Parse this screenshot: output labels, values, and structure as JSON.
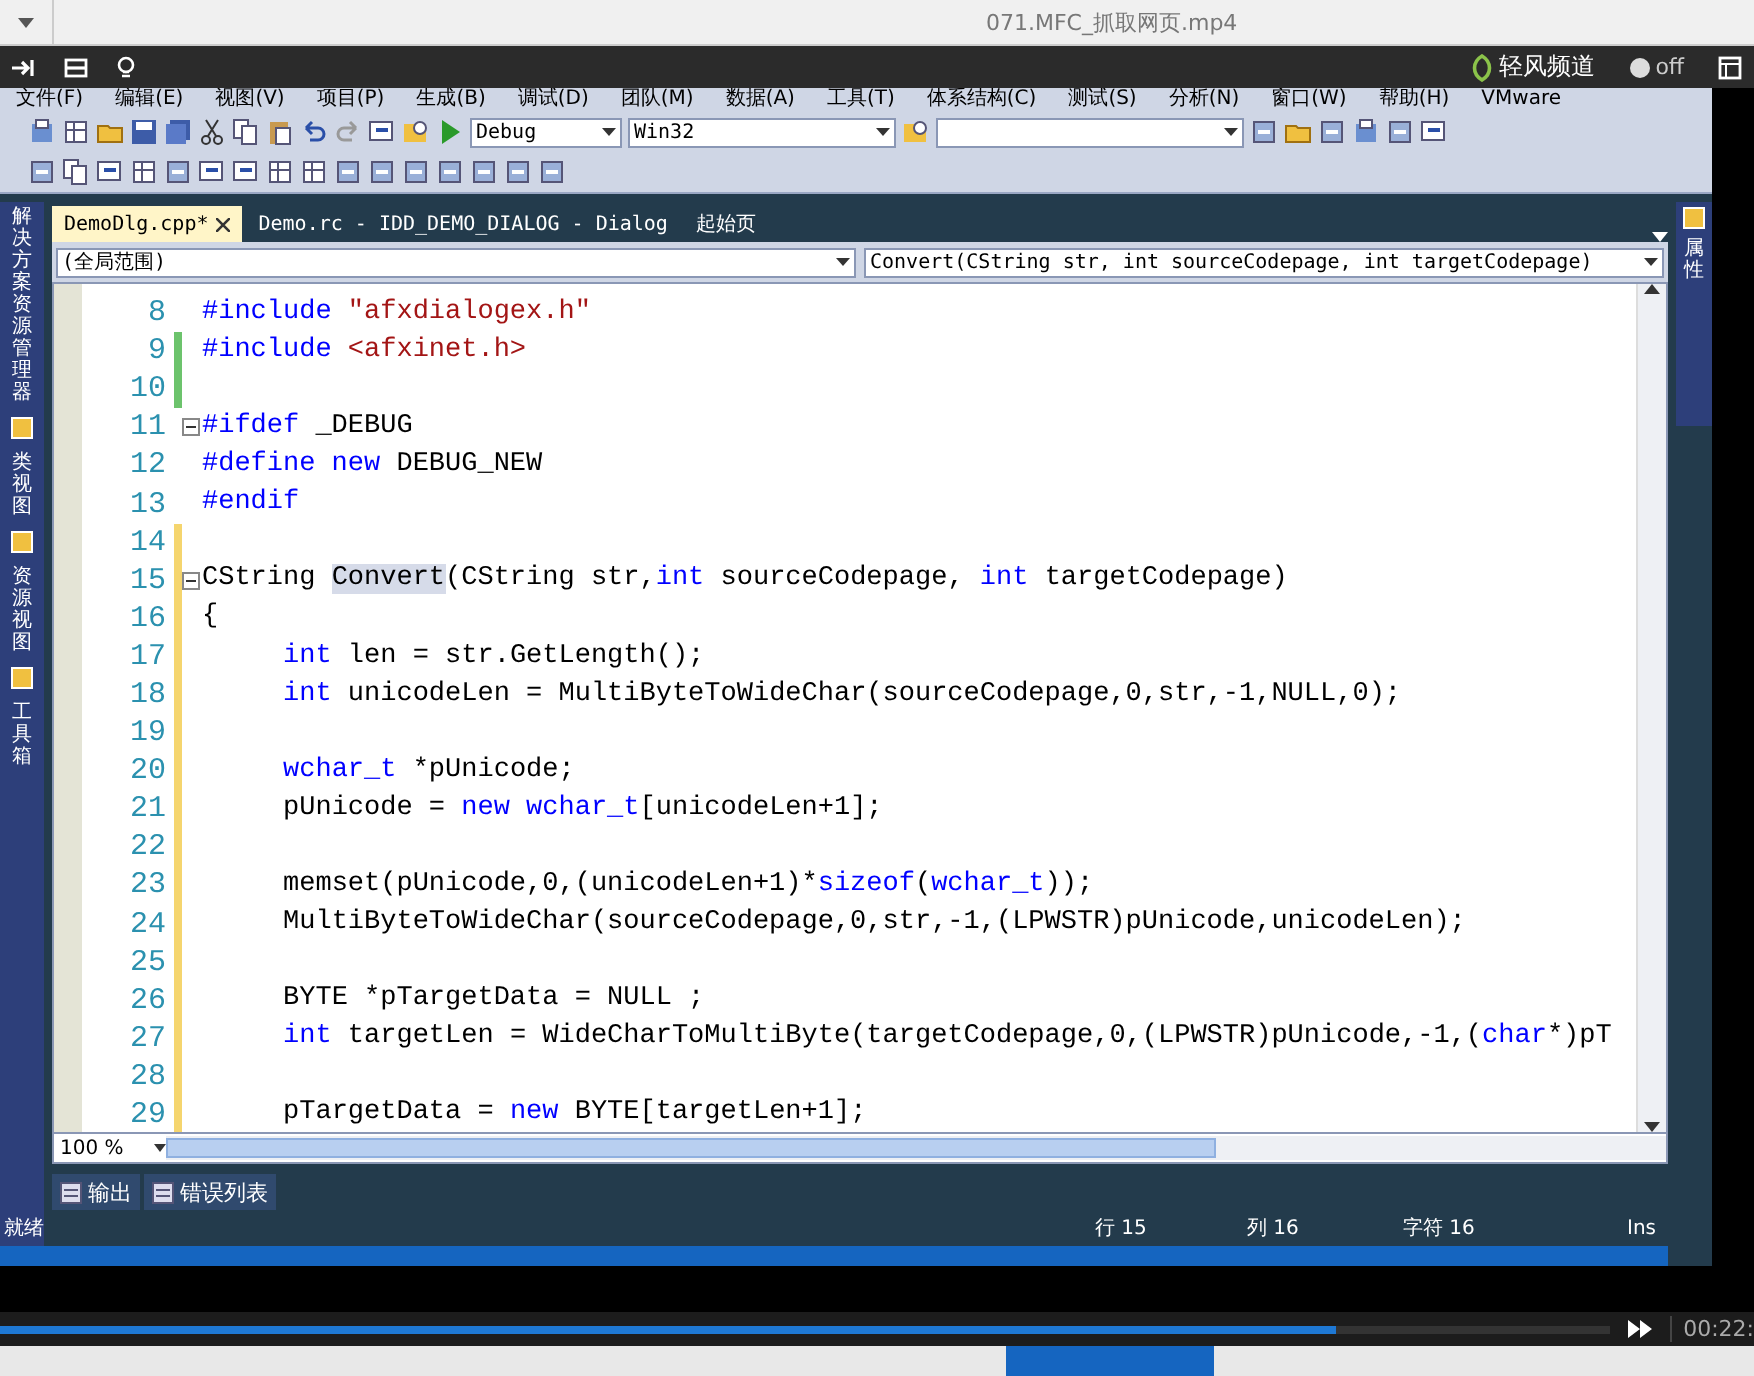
{
  "video_title": "071.MFC_抓取网页.mp4",
  "player_bar": {
    "brand": "轻风频道",
    "toggle": {
      "label": "off",
      "on": false
    }
  },
  "menu": [
    "文件(F)",
    "编辑(E)",
    "视图(V)",
    "项目(P)",
    "生成(B)",
    "调试(D)",
    "团队(M)",
    "数据(A)",
    "工具(T)",
    "体系结构(C)",
    "测试(S)",
    "分析(N)",
    "窗口(W)",
    "帮助(H)",
    "VMware"
  ],
  "toolbar": {
    "configuration": "Debug",
    "platform": "Win32"
  },
  "left_panel": [
    {
      "label": "解决方案资源管理器"
    },
    {
      "label": "类视图"
    },
    {
      "label": "资源视图"
    },
    {
      "label": "工具箱"
    }
  ],
  "right_panel": [
    {
      "label": "属性"
    }
  ],
  "tabs": [
    {
      "label": "DemoDlg.cpp*",
      "selected": true
    },
    {
      "label": "Demo.rc - IDD_DEMO_DIALOG - Dialog",
      "selected": false
    },
    {
      "label": "起始页",
      "selected": false
    }
  ],
  "scope": "(全局范围)",
  "member": "Convert(CString str, int sourceCodepage, int targetCodepage)",
  "code_lines": [
    {
      "number": "8",
      "tokens": [
        {
          "kind": "keyword",
          "text": "#include "
        },
        {
          "kind": "string",
          "text": "\"afxdialogex.h\""
        }
      ]
    },
    {
      "number": "9",
      "color": "#6cc36c",
      "tokens": [
        {
          "kind": "keyword",
          "text": "#include "
        },
        {
          "kind": "string",
          "text": "<afxinet.h>"
        }
      ]
    },
    {
      "number": "10",
      "color": "#6cc36c"
    },
    {
      "number": "11",
      "fold": true,
      "tokens": [
        {
          "kind": "keyword",
          "text": "#ifdef"
        },
        {
          "kind": "plain",
          "text": " _DEBUG"
        }
      ]
    },
    {
      "number": "12",
      "tokens": [
        {
          "kind": "keyword",
          "text": "#define new"
        },
        {
          "kind": "plain",
          "text": " DEBUG_NEW"
        }
      ]
    },
    {
      "number": "13",
      "tokens": [
        {
          "kind": "keyword",
          "text": "#endif"
        }
      ]
    },
    {
      "number": "14",
      "color": "#f5d56e"
    },
    {
      "number": "15",
      "color": "#f5d56e",
      "fold": true,
      "tokens": [
        {
          "kind": "plain",
          "text": "CString "
        },
        {
          "kind": "highlight",
          "text": "Convert"
        },
        {
          "kind": "plain",
          "text": "(CString str,"
        },
        {
          "kind": "keyword",
          "text": "int"
        },
        {
          "kind": "plain",
          "text": " sourceCodepage, "
        },
        {
          "kind": "keyword",
          "text": "int"
        },
        {
          "kind": "plain",
          "text": " targetCodepage)"
        }
      ]
    },
    {
      "number": "16",
      "color": "#f5d56e",
      "tokens": [
        {
          "kind": "plain",
          "text": "{"
        }
      ]
    },
    {
      "number": "17",
      "color": "#f5d56e",
      "tokens": [
        {
          "kind": "keyword",
          "text": "\tint"
        },
        {
          "kind": "plain",
          "text": " len = str.GetLength();"
        }
      ]
    },
    {
      "number": "18",
      "color": "#f5d56e",
      "tokens": [
        {
          "kind": "keyword",
          "text": "\tint"
        },
        {
          "kind": "plain",
          "text": " unicodeLen = MultiByteToWideChar(sourceCodepage,0,str,-1,NULL,0);"
        }
      ]
    },
    {
      "number": "19",
      "color": "#f5d56e"
    },
    {
      "number": "20",
      "color": "#f5d56e",
      "tokens": [
        {
          "kind": "keyword",
          "text": "\twchar_t"
        },
        {
          "kind": "plain",
          "text": " *pUnicode;"
        }
      ]
    },
    {
      "number": "21",
      "color": "#f5d56e",
      "tokens": [
        {
          "kind": "plain",
          "text": "\tpUnicode = "
        },
        {
          "kind": "keyword",
          "text": "new wchar_t"
        },
        {
          "kind": "plain",
          "text": "[unicodeLen+1];"
        }
      ]
    },
    {
      "number": "22",
      "color": "#f5d56e"
    },
    {
      "number": "23",
      "color": "#f5d56e",
      "tokens": [
        {
          "kind": "plain",
          "text": "\tmemset(pUnicode,0,(unicodeLen+1)*"
        },
        {
          "kind": "keyword",
          "text": "sizeof"
        },
        {
          "kind": "plain",
          "text": "("
        },
        {
          "kind": "keyword",
          "text": "wchar_t"
        },
        {
          "kind": "plain",
          "text": "));"
        }
      ]
    },
    {
      "number": "24",
      "color": "#f5d56e",
      "tokens": [
        {
          "kind": "plain",
          "text": "\tMultiByteToWideChar(sourceCodepage,0,str,-1,(LPWSTR)pUnicode,unicodeLen);"
        }
      ]
    },
    {
      "number": "25",
      "color": "#f5d56e"
    },
    {
      "number": "26",
      "color": "#f5d56e",
      "tokens": [
        {
          "kind": "plain",
          "text": "\tBYTE *pTargetData = NULL ;"
        }
      ]
    },
    {
      "number": "27",
      "color": "#f5d56e",
      "tokens": [
        {
          "kind": "keyword",
          "text": "\tint"
        },
        {
          "kind": "plain",
          "text": " targetLen = WideCharToMultiByte(targetCodepage,0,(LPWSTR)pUnicode,-1,("
        },
        {
          "kind": "keyword",
          "text": "char"
        },
        {
          "kind": "plain",
          "text": "*)pT"
        }
      ]
    },
    {
      "number": "28",
      "color": "#f5d56e"
    },
    {
      "number": "29",
      "color": "#f5d56e",
      "tokens": [
        {
          "kind": "plain",
          "text": "\tpTargetData = "
        },
        {
          "kind": "keyword",
          "text": "new"
        },
        {
          "kind": "plain",
          "text": " BYTE[targetLen+1];"
        }
      ]
    }
  ],
  "zoom": "100 %",
  "bottom_tabs": [
    {
      "label": "输出"
    },
    {
      "label": "错误列表"
    }
  ],
  "status_bar": {
    "state": "就绪",
    "line": "行 15",
    "column": "列 16",
    "char": "字符 16",
    "mode": "Ins"
  },
  "playback": {
    "level": 0.83,
    "time": "00:22:"
  }
}
